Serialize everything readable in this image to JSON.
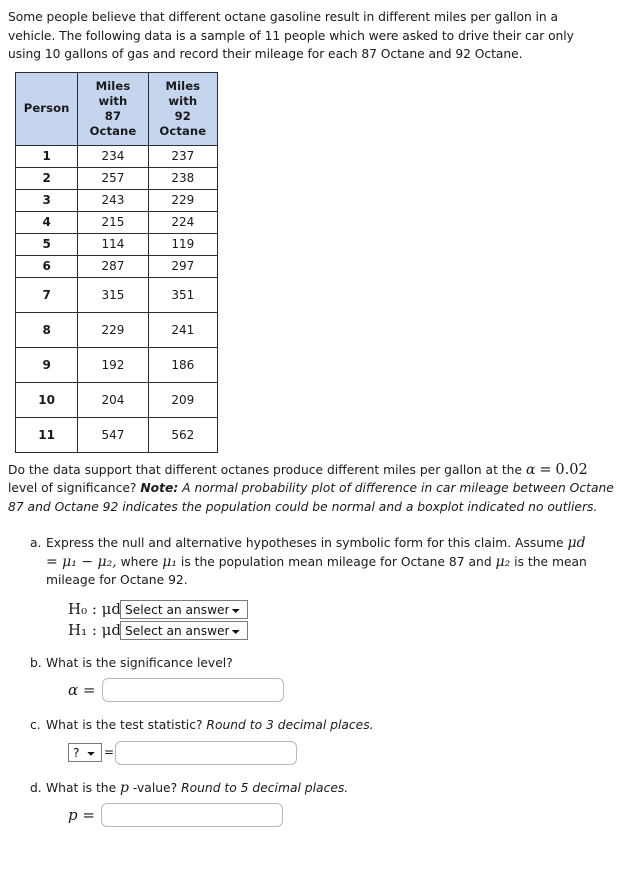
{
  "intro": {
    "paragraph": "Some people believe that different octane gasoline result in different miles per gallon in a vehicle. The following data is a sample of 11 people which were asked to drive their car only using 10 gallons of gas and record their mileage for each 87 Octane and 92 Octane."
  },
  "table": {
    "headers": [
      "Person",
      "Miles\nwith\n87\nOctane",
      "Miles\nwith\n92\nOctane"
    ],
    "rows": [
      [
        "1",
        "234",
        "237"
      ],
      [
        "2",
        "257",
        "238"
      ],
      [
        "3",
        "243",
        "229"
      ],
      [
        "4",
        "215",
        "224"
      ],
      [
        "5",
        "114",
        "119"
      ],
      [
        "6",
        "287",
        "297"
      ],
      [
        "7",
        "315",
        "351"
      ],
      [
        "8",
        "229",
        "241"
      ],
      [
        "9",
        "192",
        "186"
      ],
      [
        "10",
        "204",
        "209"
      ],
      [
        "11",
        "547",
        "562"
      ]
    ],
    "header_bg": "#c5d5ee",
    "border_color": "#2b2b35"
  },
  "question": {
    "lead": "Do the data support that different octanes produce different miles per gallon at the",
    "alpha_symbol": "α",
    "alpha_eq": "=",
    "alpha_value": "0.02",
    "after_alpha": " level of significance? ",
    "note_label": "Note:",
    "note_text": " A normal probability plot of difference in car mileage between Octane 87 and Octane 92 indicates the population could be normal and a boxplot indicated no outliers."
  },
  "parts": {
    "a": {
      "marker": "a.",
      "text_1": "Express the null and alternative hypotheses in symbolic form for this claim. Assume ",
      "formula": "μd = μ₁ − μ₂,",
      "text_2": " where ",
      "mu1": "μ₁",
      "text_3": " is the population mean mileage for Octane 87 and ",
      "mu2": "μ₂",
      "text_4": " is the mean mileage for Octane 92.",
      "h0_label": "H₀ : μd",
      "h1_label": "H₁ : μd",
      "select_value": "Select an answer",
      "select_options": [
        "Select an answer"
      ]
    },
    "b": {
      "marker": "b.",
      "text": "What is the significance level?",
      "symbol": "α",
      "equals": "=",
      "input_value": "",
      "input_placeholder": ""
    },
    "c": {
      "marker": "c.",
      "text": "What is the test statistic? ",
      "italic_text": "Round to 3 decimal places.",
      "select_value": "?",
      "select_options": [
        "?"
      ],
      "equals": "=",
      "input_value": "",
      "input_placeholder": ""
    },
    "d": {
      "marker": "d.",
      "text_1": "What is the ",
      "p_symbol": "p",
      "text_2": " -value? ",
      "italic_text": "Round to 5 decimal places.",
      "symbol": "p",
      "equals": "=",
      "input_value": "",
      "input_placeholder": ""
    }
  }
}
